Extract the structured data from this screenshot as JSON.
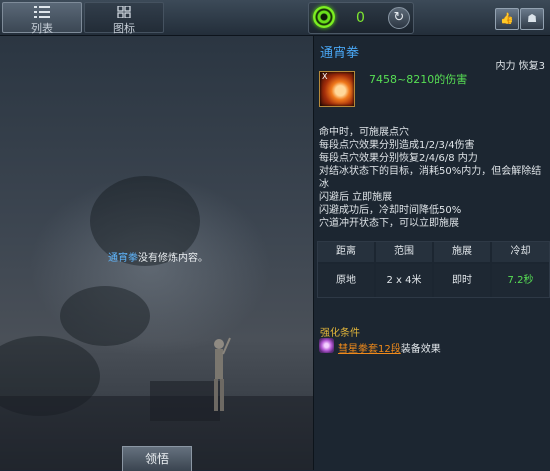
{
  "tabs": [
    {
      "label": "列表",
      "icon": "list-icon",
      "active": true
    },
    {
      "label": "图标",
      "icon": "grid-icon",
      "active": false
    }
  ],
  "counter": {
    "value": "0",
    "icon": "swirl-icon",
    "refresh_icon": "refresh-icon"
  },
  "top_buttons": [
    {
      "icon": "thumbs-up-icon"
    },
    {
      "icon": "party-icon"
    }
  ],
  "left_panel": {
    "message_skill": "通宵拳",
    "message_rest": "没有修炼内容。",
    "button_label": "领悟"
  },
  "skill": {
    "name": "通宵拳",
    "type": "内力 恢复3",
    "icon_key": "X",
    "damage": "7458~8210的伤害",
    "description": [
      "命中时，可施展点穴",
      "每段点穴效果分别造成1/2/3/4伤害",
      "每段点穴效果分别恢复2/4/6/8 内力",
      "对结冰状态下的目标，消耗50%内力，但会解除结",
      "冰",
      "闪避后 立即施展",
      "闪避成功后，冷却时间降低50%",
      "穴道冲开状态下，可以立即施展"
    ],
    "stats": {
      "headers": [
        "距离",
        "范围",
        "施展",
        "冷却"
      ],
      "values": [
        "原地",
        "2 x 4米",
        "即时",
        "7.2秒"
      ]
    },
    "enhance": {
      "title": "强化条件",
      "set_name": "彗星拳套12段",
      "effect": "装备效果"
    }
  },
  "colors": {
    "skill_name": "#49a6f3",
    "damage": "#57df54",
    "cooldown": "#57df54",
    "enhance_title": "#e0b43a",
    "set_name": "#f08a1a"
  }
}
